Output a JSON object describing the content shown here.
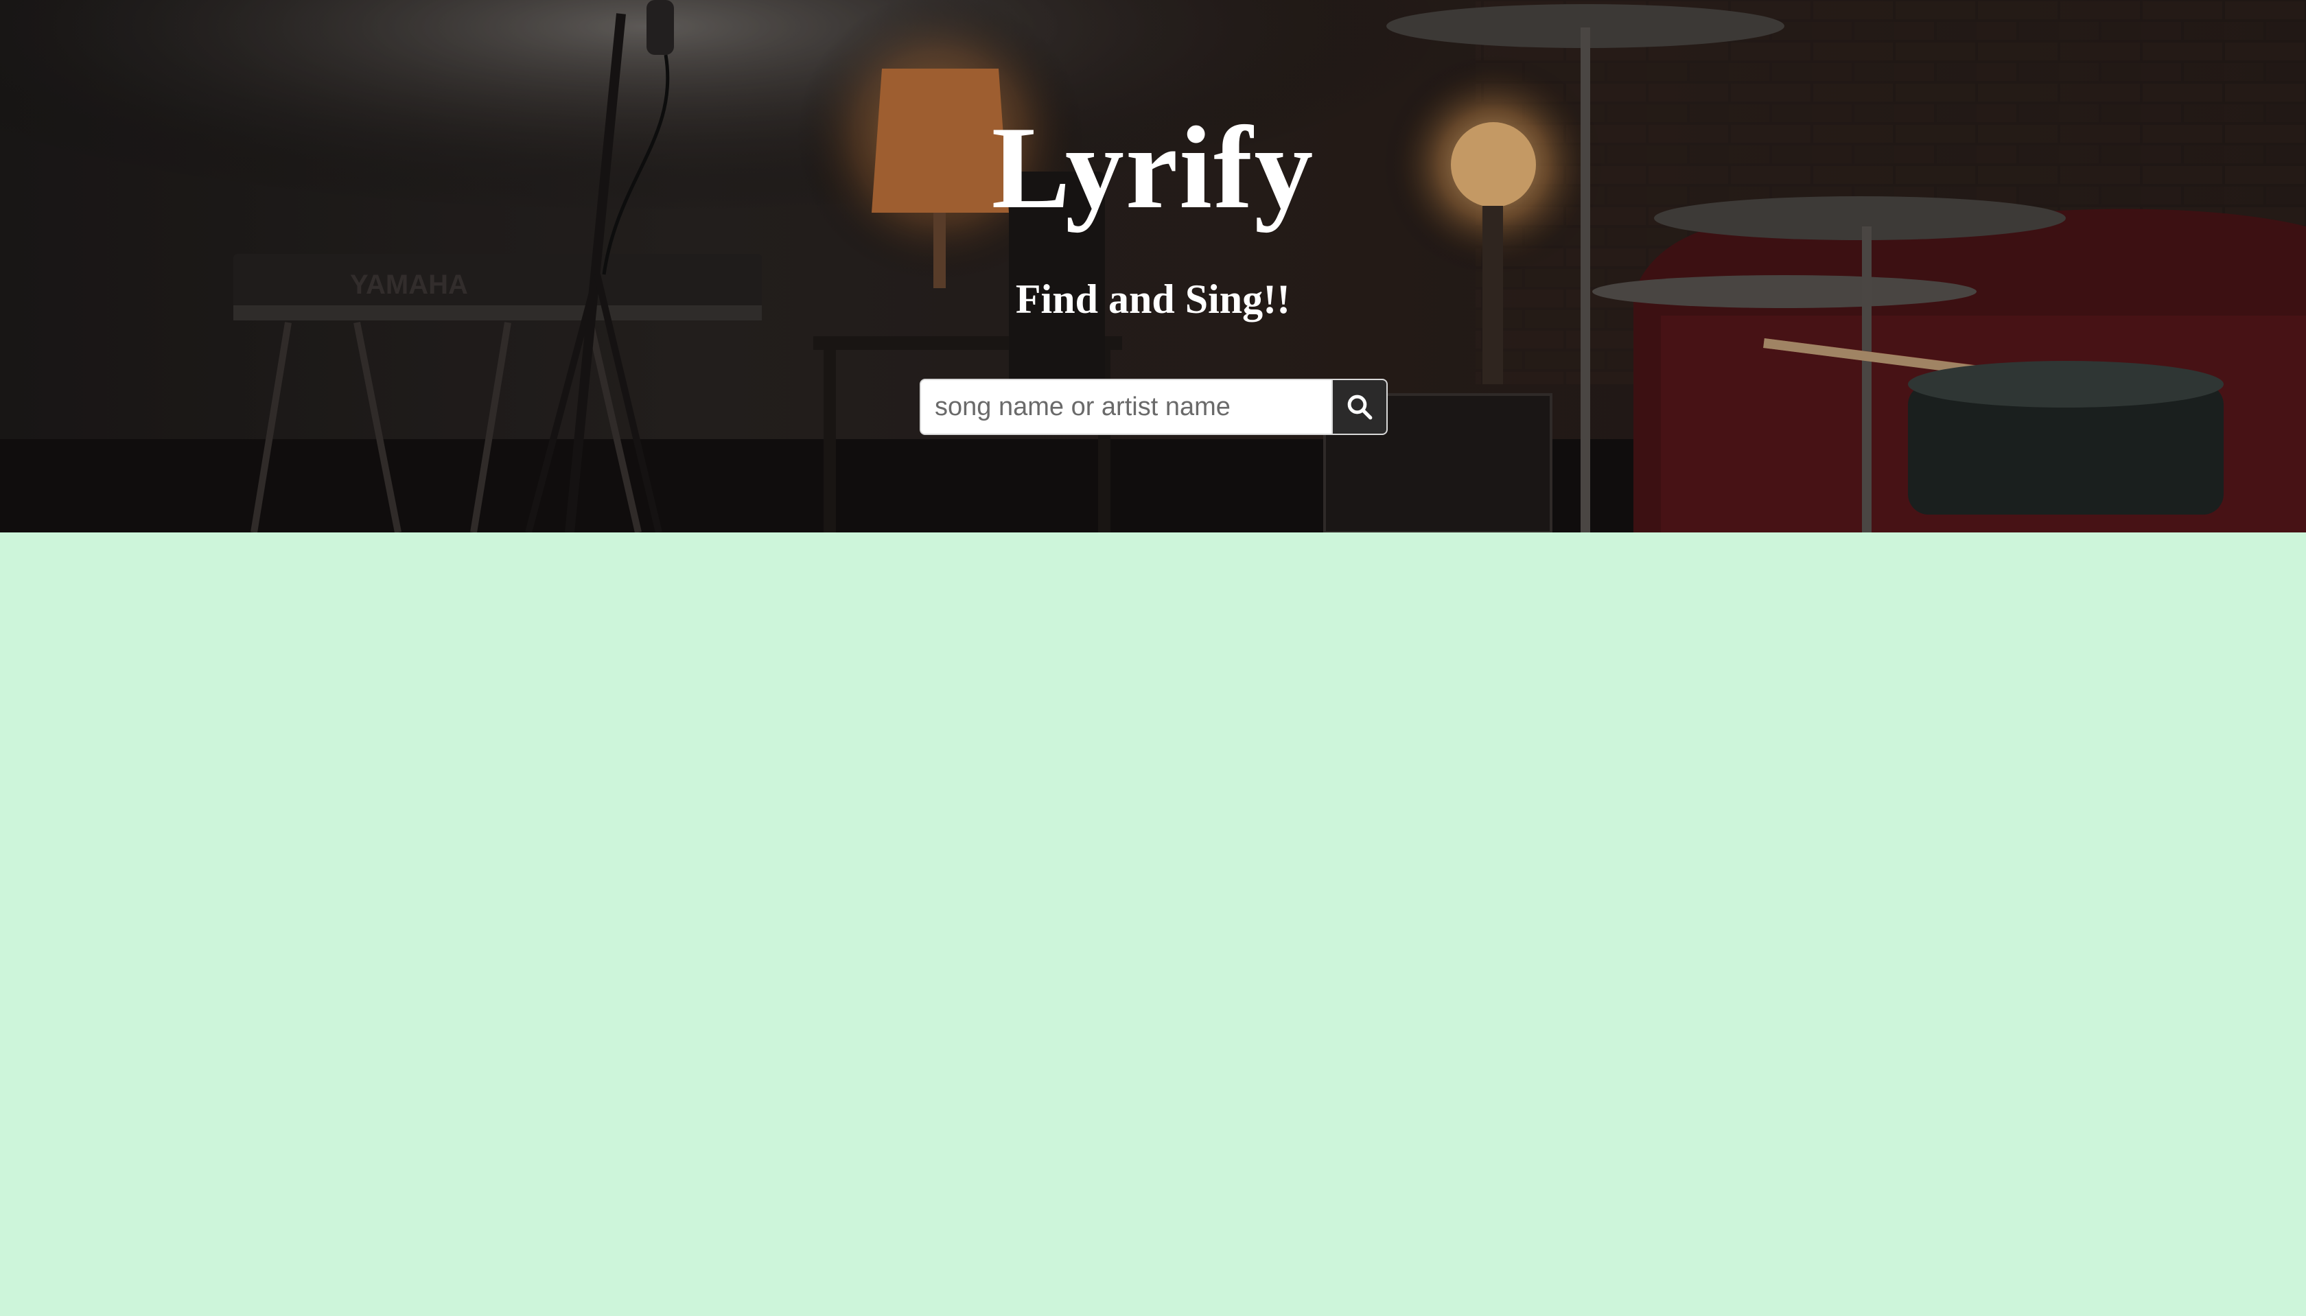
{
  "hero": {
    "title": "Lyrify",
    "tagline": "Find and Sing!!",
    "background_image": "dim-music-studio-keyboard-lamps-drum-kit",
    "keyboard_brand_text": "YAMAHA"
  },
  "search": {
    "placeholder": "song name or artist name",
    "value": "",
    "button_icon": "search-icon"
  },
  "colors": {
    "page_background": "#cdf5da",
    "title_text": "#ffffff",
    "search_button": "#2b2a2a"
  }
}
